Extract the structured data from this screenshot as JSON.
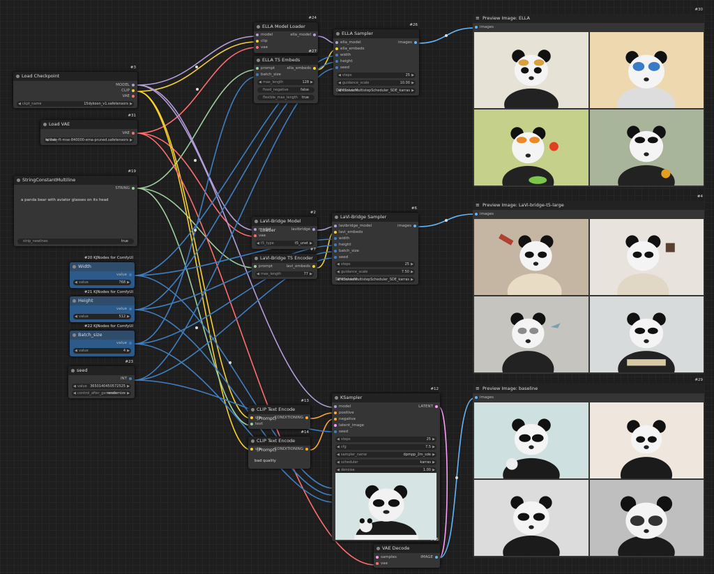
{
  "nodes": {
    "load_checkpoint": {
      "id": "#3",
      "title": "Load Checkpoint",
      "outputs": [
        "MODEL",
        "CLIP",
        "VAE"
      ],
      "widget": {
        "label": "ckpt_name",
        "value": "15dykoon_v1.safetensors"
      }
    },
    "load_vae": {
      "id": "#31",
      "title": "Load VAE",
      "outputs": [
        "VAE"
      ],
      "widget": {
        "label": "vae_",
        "value": "fullhde-ft-mse-840000-ema-pruned.safetensors"
      }
    },
    "string_const": {
      "id": "#19",
      "title": "StringConstantMultiline",
      "outputs": [
        "STRING"
      ],
      "text": "a panda bear with aviator glasses on its head",
      "widget": {
        "label": "strip_newlines",
        "value": "true"
      }
    },
    "width": {
      "id": "#20 KJNodes for ComfyUI",
      "title": "Width",
      "output": "value",
      "widget": {
        "label": "value",
        "value": "768"
      }
    },
    "height": {
      "id": "#21 KJNodes for ComfyUI",
      "title": "Height",
      "output": "value",
      "widget": {
        "label": "value",
        "value": "512"
      }
    },
    "batch": {
      "id": "#22 KJNodes for ComfyUI",
      "title": "Batch_size",
      "output": "value",
      "widget": {
        "label": "value",
        "value": "4"
      }
    },
    "seed": {
      "id": "#23",
      "title": "seed",
      "output": "INT",
      "w1": {
        "label": "value",
        "value": "3650140450572525"
      },
      "w2": {
        "label": "control_after_generate",
        "value": "randomize"
      }
    },
    "ella_loader": {
      "id": "#24",
      "title": "ELLA Model Loader",
      "inputs": [
        "model",
        "clip",
        "vae"
      ],
      "output": "ella_model"
    },
    "ella_t5": {
      "id": "#27",
      "title": "ELLA T5 Embeds",
      "inputs": [
        "prompt",
        "batch_size"
      ],
      "output": "ella_embeds",
      "w": [
        {
          "label": "max_length",
          "value": "128"
        },
        {
          "label": "fixed_negative",
          "value": "false"
        },
        {
          "label": "flexible_max_length",
          "value": "true"
        }
      ]
    },
    "ella_sampler": {
      "id": "#26",
      "title": "ELLA Sampler",
      "inputs": [
        "ella_model",
        "ella_embeds",
        "width",
        "height",
        "seed"
      ],
      "output": "images",
      "w": [
        {
          "label": "steps",
          "value": "25"
        },
        {
          "label": "guidance_scale",
          "value": "10.00"
        },
        {
          "label": "scheduler",
          "value": "DPMSolverMultistepScheduler_SDE_karras"
        }
      ]
    },
    "lavi_loader": {
      "id": "#2",
      "title": "LaVi-Bridge Model Loader",
      "inputs": [
        "model",
        "vae"
      ],
      "output": "lavibridge",
      "w": [
        {
          "label": "t5_type",
          "value": "t5_unet"
        }
      ]
    },
    "lavi_t5": {
      "id": "#7",
      "title": "LaVi-Bridge T5 Encoder",
      "inputs": [
        "prompt"
      ],
      "output": "lavi_embeds",
      "w": [
        {
          "label": "max_length",
          "value": "77"
        }
      ]
    },
    "lavi_sampler": {
      "id": "#6",
      "title": "LaVi-Bridge Sampler",
      "inputs": [
        "lavibridge_model",
        "lavi_embeds",
        "width",
        "height",
        "batch_size",
        "seed"
      ],
      "output": "images",
      "w": [
        {
          "label": "steps",
          "value": "25"
        },
        {
          "label": "guidance_scale",
          "value": "7.50"
        },
        {
          "label": "scheduler",
          "value": "DPMSolverMultistepScheduler_SDE_karras"
        }
      ]
    },
    "clip_pos": {
      "id": "#13",
      "title": "CLIP Text Encode (Prompt)",
      "inputs": [
        "clip",
        "text"
      ],
      "output": "CONDITIONING"
    },
    "clip_neg": {
      "id": "#14",
      "title": "CLIP Text Encode (Prompt)",
      "inputs": [
        "clip"
      ],
      "output": "CONDITIONING",
      "text": "bad quality"
    },
    "ksampler": {
      "id": "#12",
      "title": "KSampler",
      "inputs": [
        "model",
        "positive",
        "negative",
        "latent_image",
        "seed"
      ],
      "output": "LATENT",
      "w": [
        {
          "label": "steps",
          "value": "25"
        },
        {
          "label": "cfg",
          "value": "7.5"
        },
        {
          "label": "sampler_name",
          "value": "dpmpp_2m_sde"
        },
        {
          "label": "scheduler",
          "value": "karras"
        },
        {
          "label": "denoise",
          "value": "1.00"
        }
      ]
    },
    "vae_decode": {
      "id": "#15",
      "title": "VAE Decode",
      "inputs": [
        "samples",
        "vae"
      ],
      "output": "IMAGE"
    }
  },
  "previews": {
    "ella": {
      "id": "#30",
      "title": "Preview Image: ELLA",
      "input": "images"
    },
    "lavi": {
      "id": "#4",
      "title": "Preview Image: LaVi-bridge-t5-large",
      "input": "images"
    },
    "base": {
      "id": "#29",
      "title": "Preview Image: baseline",
      "input": "images"
    }
  },
  "colors": {
    "model": "#b39ddb",
    "clip": "#f5d033",
    "vae": "#ff6e6e",
    "string": "#9ecf9e",
    "int": "#3f7fc0",
    "latent": "#ff9cf9",
    "image": "#64b5f6",
    "cond": "#ffa931"
  }
}
